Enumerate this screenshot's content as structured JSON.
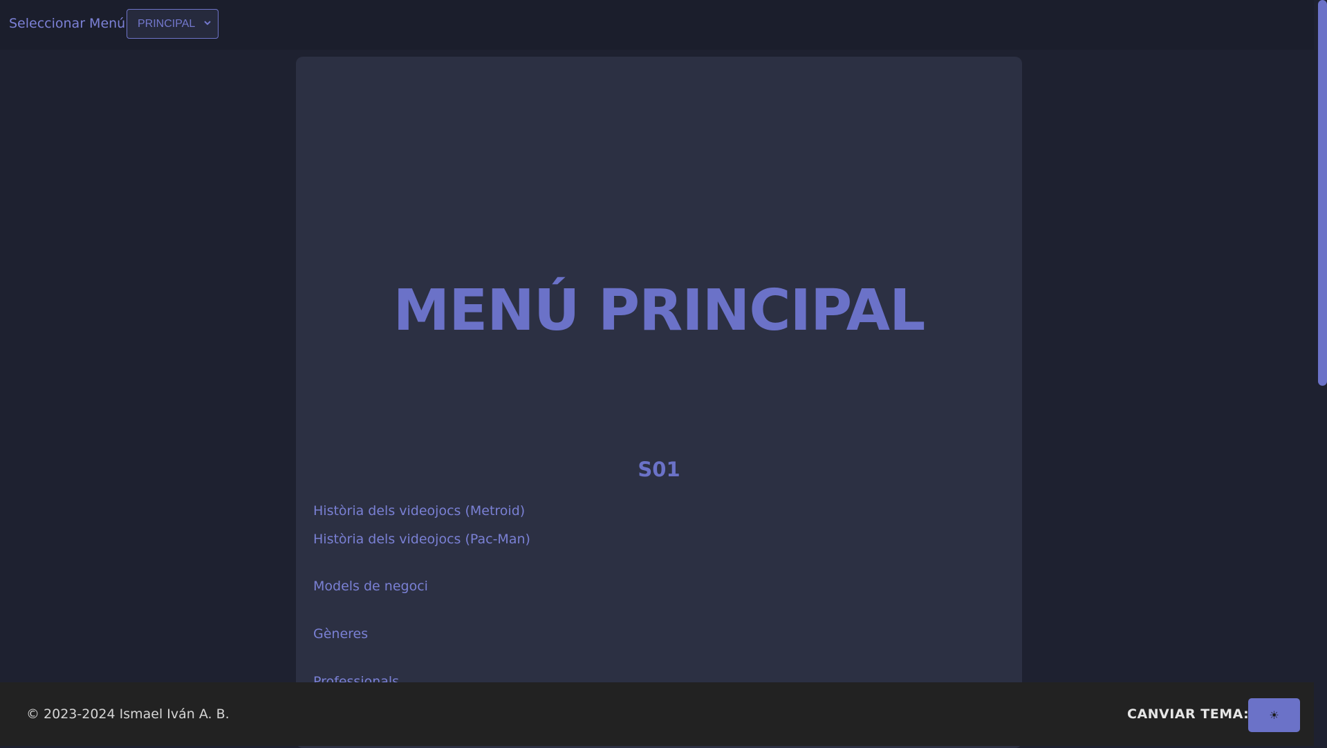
{
  "header": {
    "select_label": "Seleccionar Menú:",
    "select_value": "PRINCIPAL"
  },
  "main": {
    "title": "Menú Principal",
    "section_title": "S01",
    "links": [
      "Història dels videojocs (Metroid)",
      "Història dels videojocs (Pac-Man)",
      "Models de negoci",
      "Gèneres",
      "Professionals"
    ]
  },
  "footer": {
    "copyright": "© 2023-2024 Ismael Iván A. B.",
    "theme_label": "CANVIAR TEMA:",
    "theme_icon": "☀"
  },
  "colors": {
    "accent": "#6b72c8",
    "background": "#1e2130",
    "panel": "#2c3043",
    "footer": "#222222"
  }
}
